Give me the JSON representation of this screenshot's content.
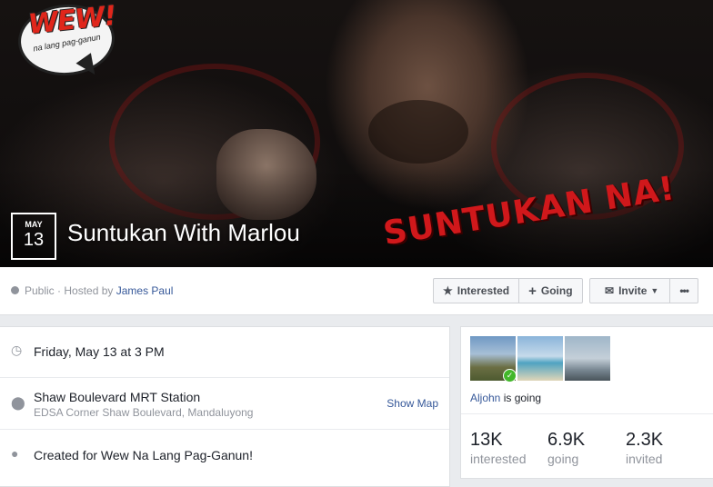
{
  "cover": {
    "logo_text": "WEW!",
    "logo_sub": "na lang pag-ganun",
    "poster_text": "SUNTUKAN NA!"
  },
  "event": {
    "month": "MAY",
    "day": "13",
    "title": "Suntukan With Marlou"
  },
  "privacy": {
    "prefix": "Public · Hosted by ",
    "host": "James Paul"
  },
  "actions": {
    "interested": "Interested",
    "going": "Going",
    "invite": "Invite",
    "more": "•••"
  },
  "details": {
    "datetime": "Friday, May 13 at 3 PM",
    "location_name": "Shaw Boulevard MRT Station",
    "location_address": "EDSA Corner Shaw Boulevard, Mandaluyong",
    "show_map": "Show Map",
    "created_for": "Created for Wew Na Lang Pag-Ganun!"
  },
  "social": {
    "friend_name": "Aljohn",
    "friend_status": " is going",
    "stats": [
      {
        "num": "13K",
        "label": "interested"
      },
      {
        "num": "6.9K",
        "label": "going"
      },
      {
        "num": "2.3K",
        "label": "invited"
      }
    ]
  },
  "icons": {
    "globe": "globe-icon",
    "star": "star-icon",
    "plus": "plus-icon",
    "envelope": "envelope-icon",
    "clock": "clock-icon",
    "pin": "location-pin-icon",
    "group": "group-icon",
    "check": "check-icon"
  },
  "colors": {
    "link": "#365899",
    "bg": "#e9ebee",
    "poster_red": "#d0181b"
  }
}
